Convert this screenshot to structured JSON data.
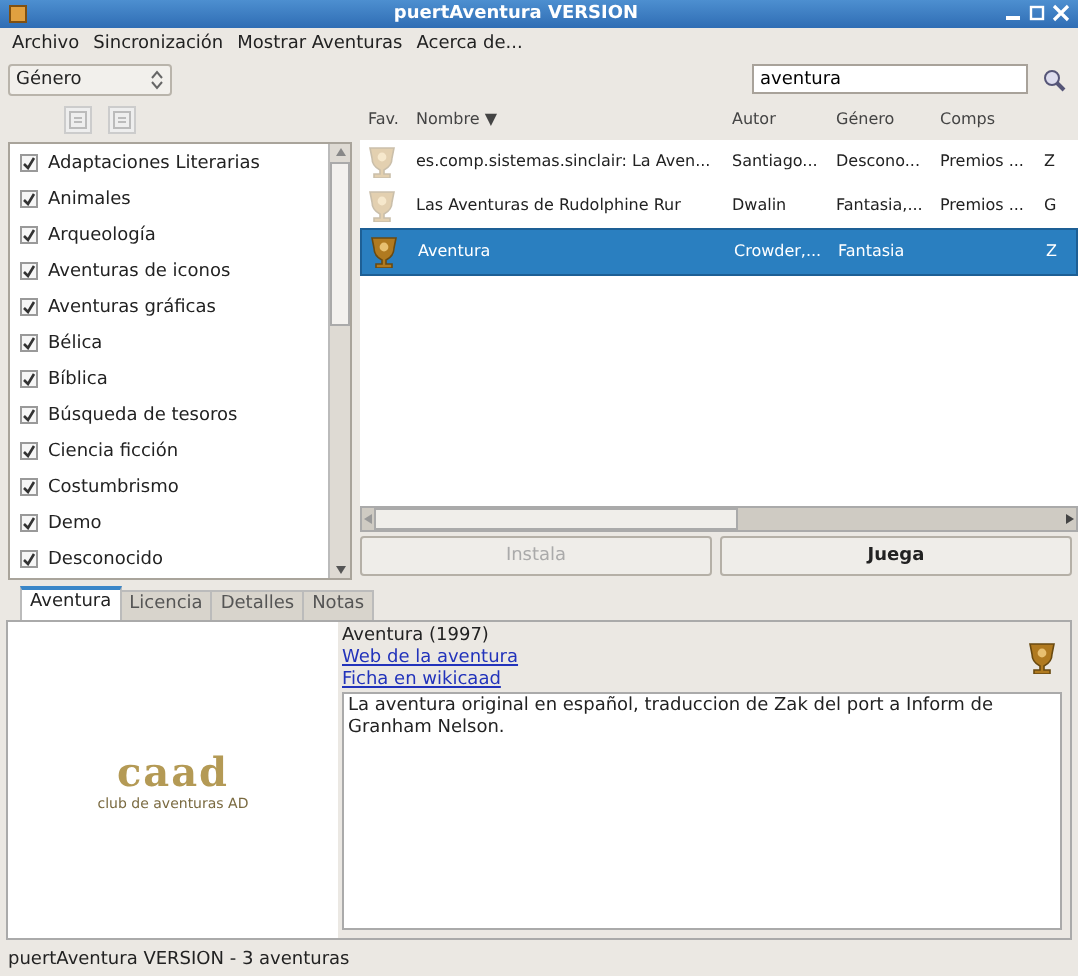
{
  "window": {
    "title": "puertAventura VERSION"
  },
  "menu": [
    "Archivo",
    "Sincronización",
    "Mostrar Aventuras",
    "Acerca de..."
  ],
  "filter": {
    "value": "Género"
  },
  "search": {
    "value": "aventura"
  },
  "genres": [
    {
      "label": "Adaptaciones Literarias",
      "checked": true
    },
    {
      "label": "Animales",
      "checked": true
    },
    {
      "label": "Arqueología",
      "checked": true
    },
    {
      "label": "Aventuras de iconos",
      "checked": true
    },
    {
      "label": "Aventuras gráficas",
      "checked": true
    },
    {
      "label": "Bélica",
      "checked": true
    },
    {
      "label": "Bíblica",
      "checked": true
    },
    {
      "label": "Búsqueda de tesoros",
      "checked": true
    },
    {
      "label": "Ciencia ficción",
      "checked": true
    },
    {
      "label": "Costumbrismo",
      "checked": true
    },
    {
      "label": "Demo",
      "checked": true
    },
    {
      "label": "Desconocido",
      "checked": true
    }
  ],
  "table": {
    "columns": [
      "Fav.",
      "Nombre ▼",
      "Autor",
      "Género",
      "Comps"
    ],
    "rows": [
      {
        "favorite": false,
        "selected": false,
        "cells": [
          "",
          "es.comp.sistemas.sinclair: La Aven...",
          "Santiago...",
          "Descono...",
          "Premios ...",
          "Z"
        ]
      },
      {
        "favorite": false,
        "selected": false,
        "cells": [
          "",
          "Las Aventuras de Rudolphine Rur",
          "Dwalin",
          "Fantasia,...",
          "Premios ...",
          "G"
        ]
      },
      {
        "favorite": true,
        "selected": true,
        "cells": [
          "",
          "Aventura",
          "Crowder,...",
          "Fantasia",
          "",
          "Z"
        ]
      }
    ]
  },
  "actions": [
    {
      "label": "Instala",
      "disabled": true
    },
    {
      "label": "Juega",
      "disabled": false
    }
  ],
  "tabs": [
    {
      "label": "Aventura",
      "selected": true
    },
    {
      "label": "Licencia",
      "selected": false
    },
    {
      "label": "Detalles",
      "selected": false
    },
    {
      "label": "Notas",
      "selected": false
    }
  ],
  "logo": {
    "title": "caad",
    "subtitle": "club de aventuras AD"
  },
  "detail": {
    "heading": "Aventura (1997)",
    "links": [
      "Web de la aventura",
      "Ficha en wikicaad"
    ],
    "favorite": true,
    "description": "La aventura original en español, traduccion de Zak del port a Inform de Granham Nelson."
  },
  "status_bar": "puertAventura VERSION - 3 aventuras"
}
